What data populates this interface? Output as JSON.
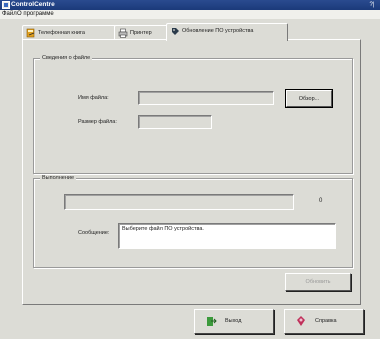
{
  "window": {
    "title": "ControlCentre",
    "title_button": "?|"
  },
  "menu": {
    "items": [
      "Файл",
      "О программе"
    ]
  },
  "tabs": [
    {
      "label": "Телефонная книга",
      "icon": "phonebook-icon"
    },
    {
      "label": "Принтер",
      "icon": "printer-icon"
    },
    {
      "label": "Обновление ПО устройства",
      "icon": "firmware-icon",
      "active": true
    }
  ],
  "file_info": {
    "legend": "Сведения о файле",
    "name_label": "Имя файла:",
    "name_value": "",
    "size_label": "Размер файла:",
    "size_value": "",
    "browse_label": "Обзор..."
  },
  "progress": {
    "legend": "Выполнение",
    "value": 0,
    "percent_text": "0",
    "message_label": "Сообщение:",
    "message_text": "Выберите файл ПО устройства."
  },
  "update_button": {
    "label": "Обновить",
    "enabled": false
  },
  "footer": {
    "exit_label": "Выход",
    "help_label": "Справка"
  },
  "colors": {
    "title_bar": "#1b3a7a",
    "face": "#dcdcd6",
    "disabled_text": "#9a9a9a"
  }
}
